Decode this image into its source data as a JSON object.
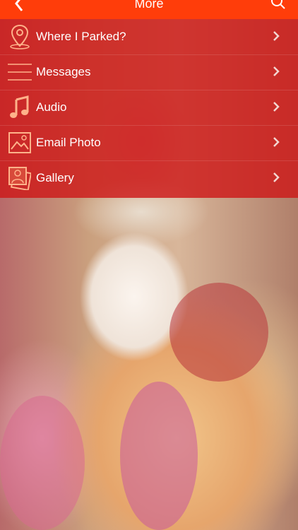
{
  "header": {
    "back_icon": "chevron-left-icon",
    "title": "More",
    "search_icon": "search-icon"
  },
  "menu": {
    "items": [
      {
        "label": "Where I Parked?",
        "icon": "map-pin-icon"
      },
      {
        "label": "Messages",
        "icon": "lines-icon"
      },
      {
        "label": "Audio",
        "icon": "music-note-icon"
      },
      {
        "label": "Email Photo",
        "icon": "photo-icon"
      },
      {
        "label": "Gallery",
        "icon": "gallery-icon"
      }
    ]
  },
  "colors": {
    "nav_bar": "#ff3d0a",
    "menu_overlay": "#cd1919",
    "icon_tint": "#ffb28a"
  }
}
